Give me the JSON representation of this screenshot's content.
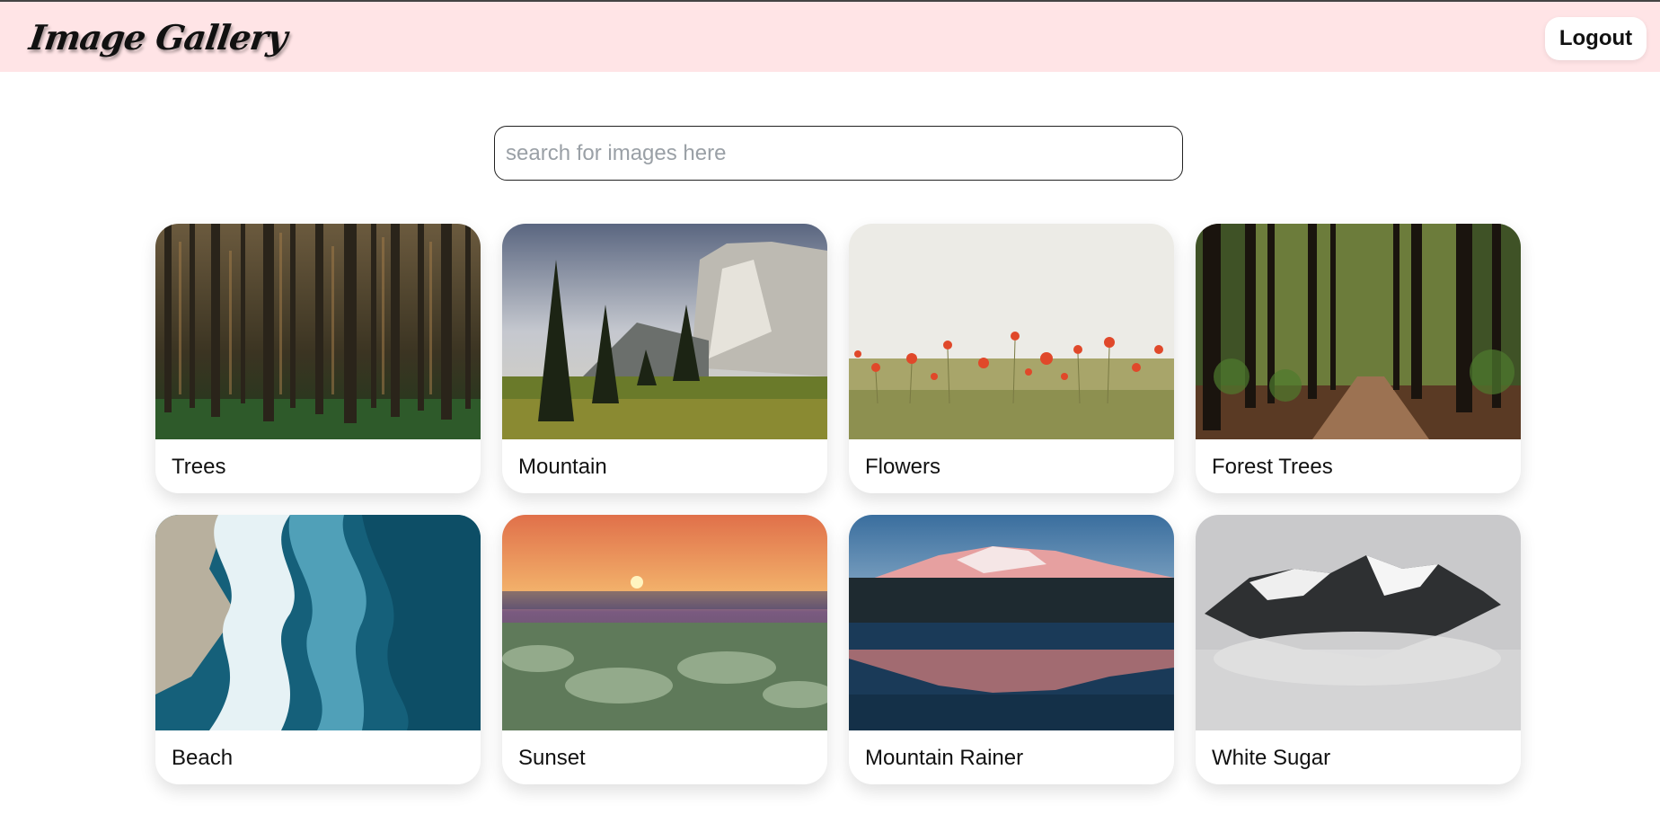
{
  "navbar": {
    "logo_text": "Image Gallery",
    "logout_label": "Logout",
    "background": "#ffe4e6"
  },
  "search": {
    "placeholder": "search for images here",
    "value": ""
  },
  "gallery": {
    "cards": [
      {
        "label": "Trees"
      },
      {
        "label": "Mountain"
      },
      {
        "label": "Flowers"
      },
      {
        "label": "Forest Trees"
      },
      {
        "label": "Beach"
      },
      {
        "label": "Sunset"
      },
      {
        "label": "Mountain Rainer"
      },
      {
        "label": "White Sugar"
      }
    ]
  }
}
